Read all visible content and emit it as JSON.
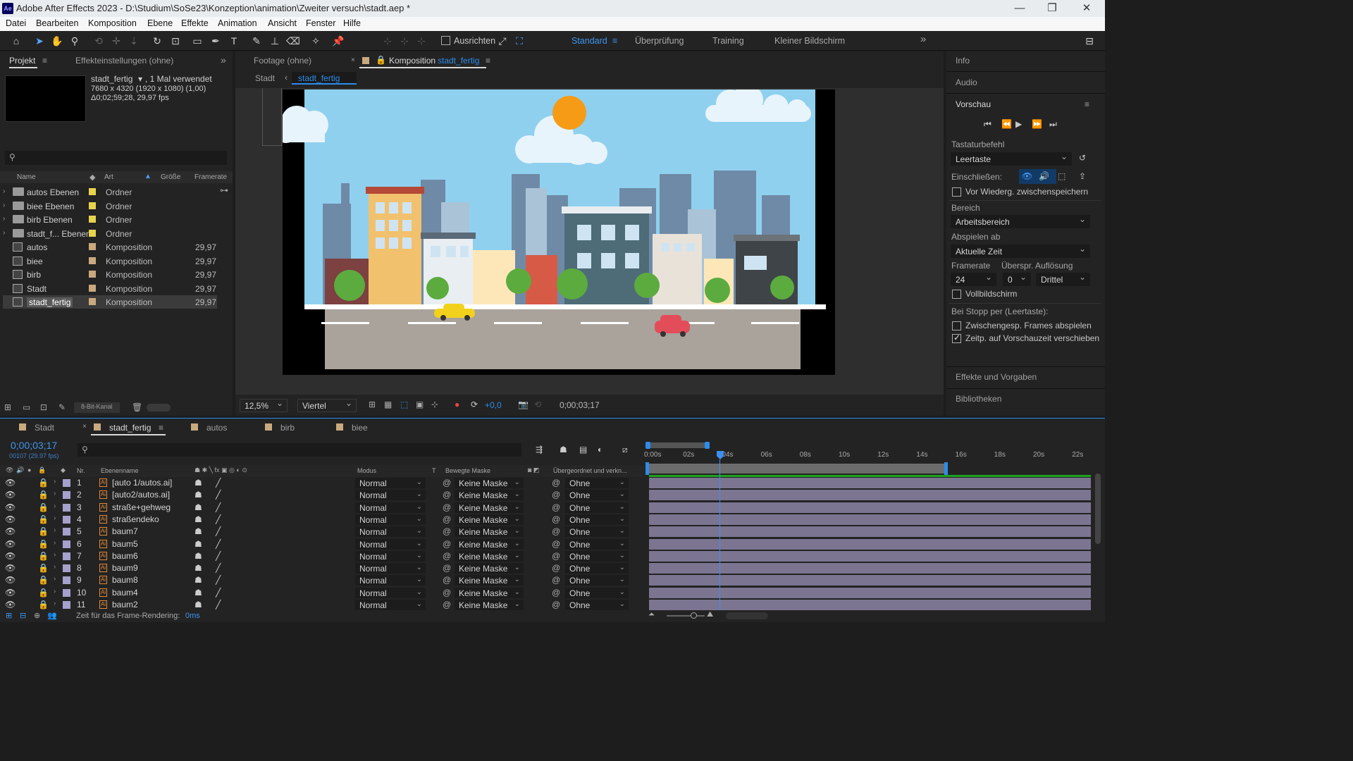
{
  "titlebar": {
    "app_icon": "Ae",
    "title": "Adobe After Effects 2023 - D:\\Studium\\SoSe23\\Konzeption\\animation\\Zweiter versuch\\stadt.aep *",
    "minimize": "—",
    "maximize": "❐",
    "close": "✕"
  },
  "menu": [
    "Datei",
    "Bearbeiten",
    "Komposition",
    "Ebene",
    "Effekte",
    "Animation",
    "Ansicht",
    "Fenster",
    "Hilfe"
  ],
  "toolbar": {
    "ausrichten": "Ausrichten",
    "workspaces": [
      "Standard",
      "Überprüfung",
      "Training",
      "Kleiner Bildschirm"
    ],
    "active_workspace": "Standard",
    "more": "»"
  },
  "project": {
    "tab_projekt": "Projekt",
    "tab_effekte": "Effekteinstellungen (ohne)",
    "thumb_name": "stadt_fertig",
    "used": ", 1 Mal verwendet",
    "dims": "7680 x 4320  (1920 x 1080) (1,00)",
    "duration": "Δ0;02;59;28, 29,97 fps",
    "search_placeholder": "",
    "columns": {
      "name": "Name",
      "art": "Art",
      "groesse": "Größe",
      "framerate": "Framerate"
    },
    "items": [
      {
        "name": "autos Ebenen",
        "type": "Ordner",
        "fps": "",
        "kind": "folder",
        "color": "#e6d34e"
      },
      {
        "name": "biee Ebenen",
        "type": "Ordner",
        "fps": "",
        "kind": "folder",
        "color": "#e6d34e"
      },
      {
        "name": "birb Ebenen",
        "type": "Ordner",
        "fps": "",
        "kind": "folder",
        "color": "#e6d34e"
      },
      {
        "name": "stadt_f... Ebenen",
        "type": "Ordner",
        "fps": "",
        "kind": "folder",
        "color": "#e6d34e"
      },
      {
        "name": "autos",
        "type": "Komposition",
        "fps": "29,97",
        "kind": "comp",
        "color": "#c9a97e"
      },
      {
        "name": "biee",
        "type": "Komposition",
        "fps": "29,97",
        "kind": "comp",
        "color": "#c9a97e"
      },
      {
        "name": "birb",
        "type": "Komposition",
        "fps": "29,97",
        "kind": "comp",
        "color": "#c9a97e"
      },
      {
        "name": "Stadt",
        "type": "Komposition",
        "fps": "29,97",
        "kind": "comp",
        "color": "#c9a97e"
      },
      {
        "name": "stadt_fertig",
        "type": "Komposition",
        "fps": "29,97",
        "kind": "comp",
        "color": "#c9a97e"
      }
    ],
    "bitdepth": "8-Bit-Kanal"
  },
  "viewer": {
    "tab_footage": "Footage  (ohne)",
    "tab_comp_prefix": "Komposition",
    "tab_comp_name": "stadt_fertig",
    "crumb_parent": "Stadt",
    "crumb_current": "stadt_fertig",
    "zoom": "12,5%",
    "resolution": "Viertel",
    "exposure": "+0,0",
    "timecode": "0;00;03;17"
  },
  "right": {
    "info": "Info",
    "audio": "Audio",
    "vorschau": "Vorschau",
    "tastaturbefehl": "Tastaturbefehl",
    "leertaste": "Leertaste",
    "einschliessen": "Einschließen:",
    "vor_wiedergabe": "Vor Wiederg. zwischenspeichern",
    "bereich": "Bereich",
    "arbeitsbereich": "Arbeitsbereich",
    "abspielen_ab": "Abspielen ab",
    "aktuelle_zeit": "Aktuelle Zeit",
    "framerate": "Framerate",
    "ueberspr": "Überspr.",
    "aufloesung": "Auflösung",
    "fps_val": "24",
    "skip_val": "0",
    "res_val": "Drittel",
    "vollbild": "Vollbildschirm",
    "bei_stopp": "Bei Stopp per (Leertaste):",
    "zwischengesp": "Zwischengesp. Frames abspielen",
    "zeitp": "Zeitp. auf Vorschauzeit verschieben",
    "effekte": "Effekte und Vorgaben",
    "bibliotheken": "Bibliotheken"
  },
  "timeline": {
    "tabs": [
      "Stadt",
      "stadt_fertig",
      "autos",
      "birb",
      "biee"
    ],
    "active_tab": "stadt_fertig",
    "timecode": "0;00;03;17",
    "frames": "00107 (29.97 fps)",
    "col_nr": "Nr.",
    "col_name": "Ebenenname",
    "col_modus": "Modus",
    "col_t": "T",
    "col_maske": "Bewegte Maske",
    "col_parent": "Übergeordnet und verkn...",
    "ruler": [
      "0:00s",
      "02s",
      "04s",
      "06s",
      "08s",
      "10s",
      "12s",
      "14s",
      "16s",
      "18s",
      "20s",
      "22s"
    ],
    "layers": [
      {
        "nr": "1",
        "name": "[auto 1/autos.ai]",
        "mode": "Normal",
        "mask": "Keine Maske",
        "parent": "Ohne"
      },
      {
        "nr": "2",
        "name": "[auto2/autos.ai]",
        "mode": "Normal",
        "mask": "Keine Maske",
        "parent": "Ohne"
      },
      {
        "nr": "3",
        "name": "straße+gehweg",
        "mode": "Normal",
        "mask": "Keine Maske",
        "parent": "Ohne"
      },
      {
        "nr": "4",
        "name": "straßendeko",
        "mode": "Normal",
        "mask": "Keine Maske",
        "parent": "Ohne"
      },
      {
        "nr": "5",
        "name": "baum7",
        "mode": "Normal",
        "mask": "Keine Maske",
        "parent": "Ohne"
      },
      {
        "nr": "6",
        "name": "baum5",
        "mode": "Normal",
        "mask": "Keine Maske",
        "parent": "Ohne"
      },
      {
        "nr": "7",
        "name": "baum6",
        "mode": "Normal",
        "mask": "Keine Maske",
        "parent": "Ohne"
      },
      {
        "nr": "8",
        "name": "baum9",
        "mode": "Normal",
        "mask": "Keine Maske",
        "parent": "Ohne"
      },
      {
        "nr": "9",
        "name": "baum8",
        "mode": "Normal",
        "mask": "Keine Maske",
        "parent": "Ohne"
      },
      {
        "nr": "10",
        "name": "baum4",
        "mode": "Normal",
        "mask": "Keine Maske",
        "parent": "Ohne"
      },
      {
        "nr": "11",
        "name": "baum2",
        "mode": "Normal",
        "mask": "Keine Maske",
        "parent": "Ohne"
      }
    ],
    "render_label": "Zeit für das Frame-Rendering:",
    "render_value": "0ms"
  }
}
